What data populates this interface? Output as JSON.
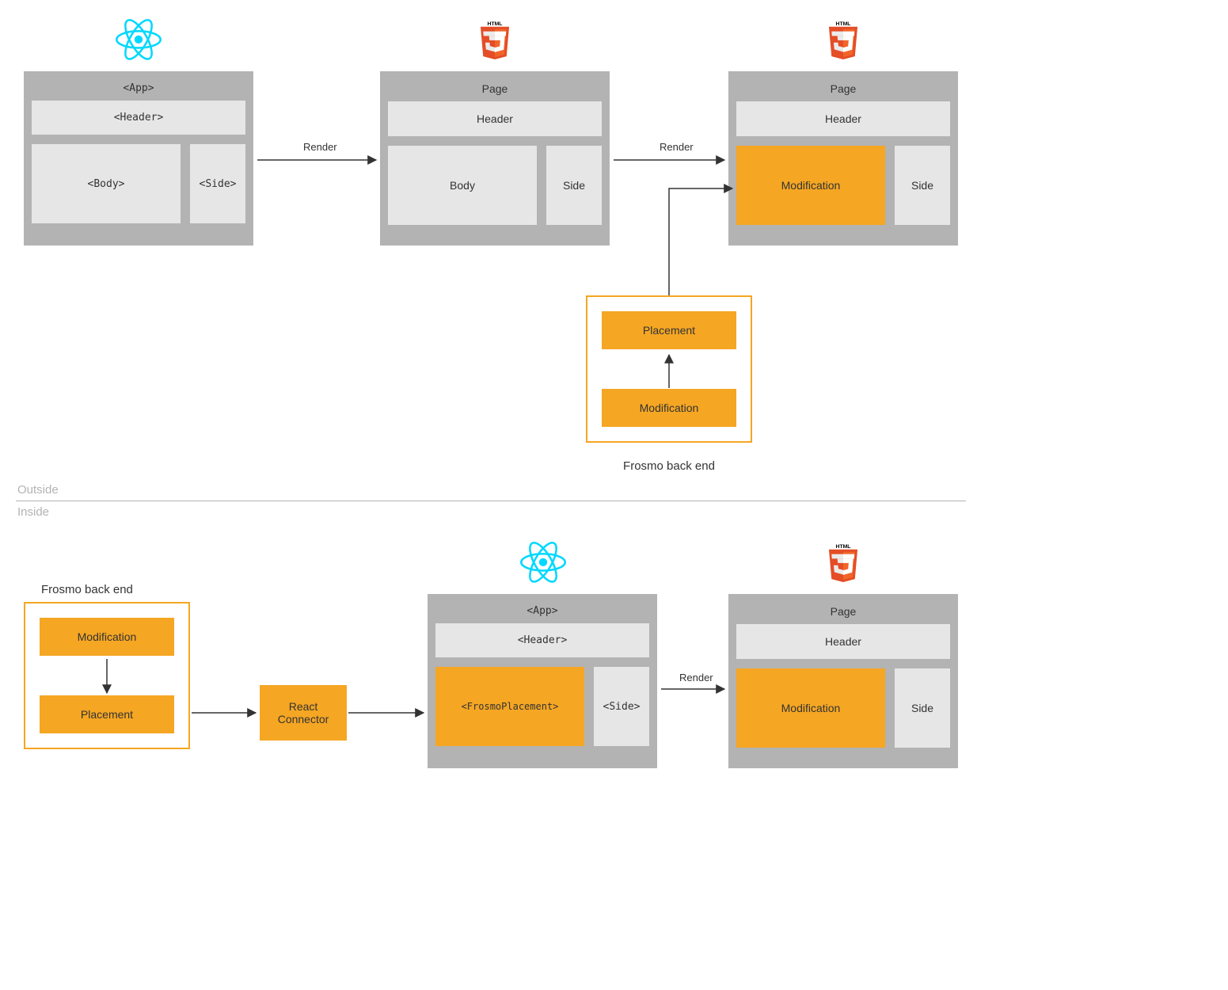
{
  "dividers": {
    "outside": "Outside",
    "inside": "Inside"
  },
  "arrows": {
    "render": "Render"
  },
  "frosmo": {
    "caption": "Frosmo back end",
    "placement": "Placement",
    "modification": "Modification",
    "react_connector": "React\nConnector"
  },
  "topRow": {
    "react": {
      "title": "<App>",
      "header": "<Header>",
      "body": "<Body>",
      "side": "<Side>"
    },
    "page1": {
      "title": "Page",
      "header": "Header",
      "body": "Body",
      "side": "Side"
    },
    "page2": {
      "title": "Page",
      "header": "Header",
      "body": "Modification",
      "side": "Side"
    }
  },
  "bottomRow": {
    "react": {
      "title": "<App>",
      "header": "<Header>",
      "body": "<FrosmoPlacement>",
      "side": "<Side>"
    },
    "page": {
      "title": "Page",
      "header": "Header",
      "body": "Modification",
      "side": "Side"
    }
  }
}
